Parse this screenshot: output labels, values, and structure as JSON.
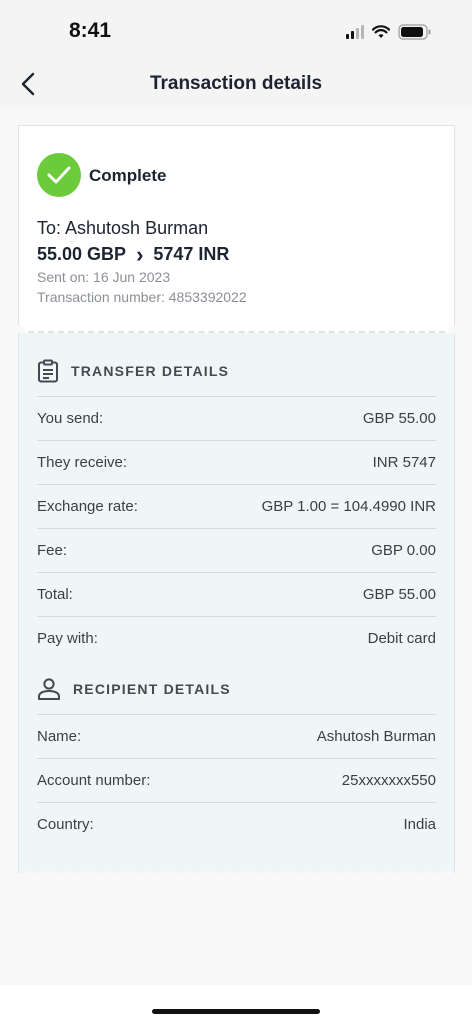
{
  "status_bar": {
    "time": "8:41"
  },
  "header": {
    "title": "Transaction details"
  },
  "summary": {
    "status": "Complete",
    "recipient_line": "To: Ashutosh Burman",
    "send_amount": "55.00 GBP",
    "arrow": "›",
    "receive_amount": "5747 INR",
    "sent_on": "Sent on: 16 Jun 2023",
    "transaction_number": "Transaction number: 4853392022"
  },
  "transfer_details": {
    "heading": "TRANSFER DETAILS",
    "rows": [
      {
        "label": "You send:",
        "value": "GBP 55.00"
      },
      {
        "label": "They receive:",
        "value": "INR 5747"
      },
      {
        "label": "Exchange rate:",
        "value": "GBP 1.00 = 104.4990 INR"
      },
      {
        "label": "Fee:",
        "value": "GBP 0.00"
      },
      {
        "label": "Total:",
        "value": "GBP 55.00"
      },
      {
        "label": "Pay with:",
        "value": "Debit card"
      }
    ]
  },
  "recipient_details": {
    "heading": "RECIPIENT DETAILS",
    "rows": [
      {
        "label": "Name:",
        "value": "Ashutosh Burman"
      },
      {
        "label": "Account number:",
        "value": "25xxxxxxx550"
      },
      {
        "label": "Country:",
        "value": "India"
      }
    ]
  },
  "colors": {
    "success": "#6bcb3a",
    "details_bg": "#eff7f6"
  },
  "icons": [
    "back-chevron-icon",
    "check-icon",
    "clipboard-icon",
    "person-icon"
  ]
}
